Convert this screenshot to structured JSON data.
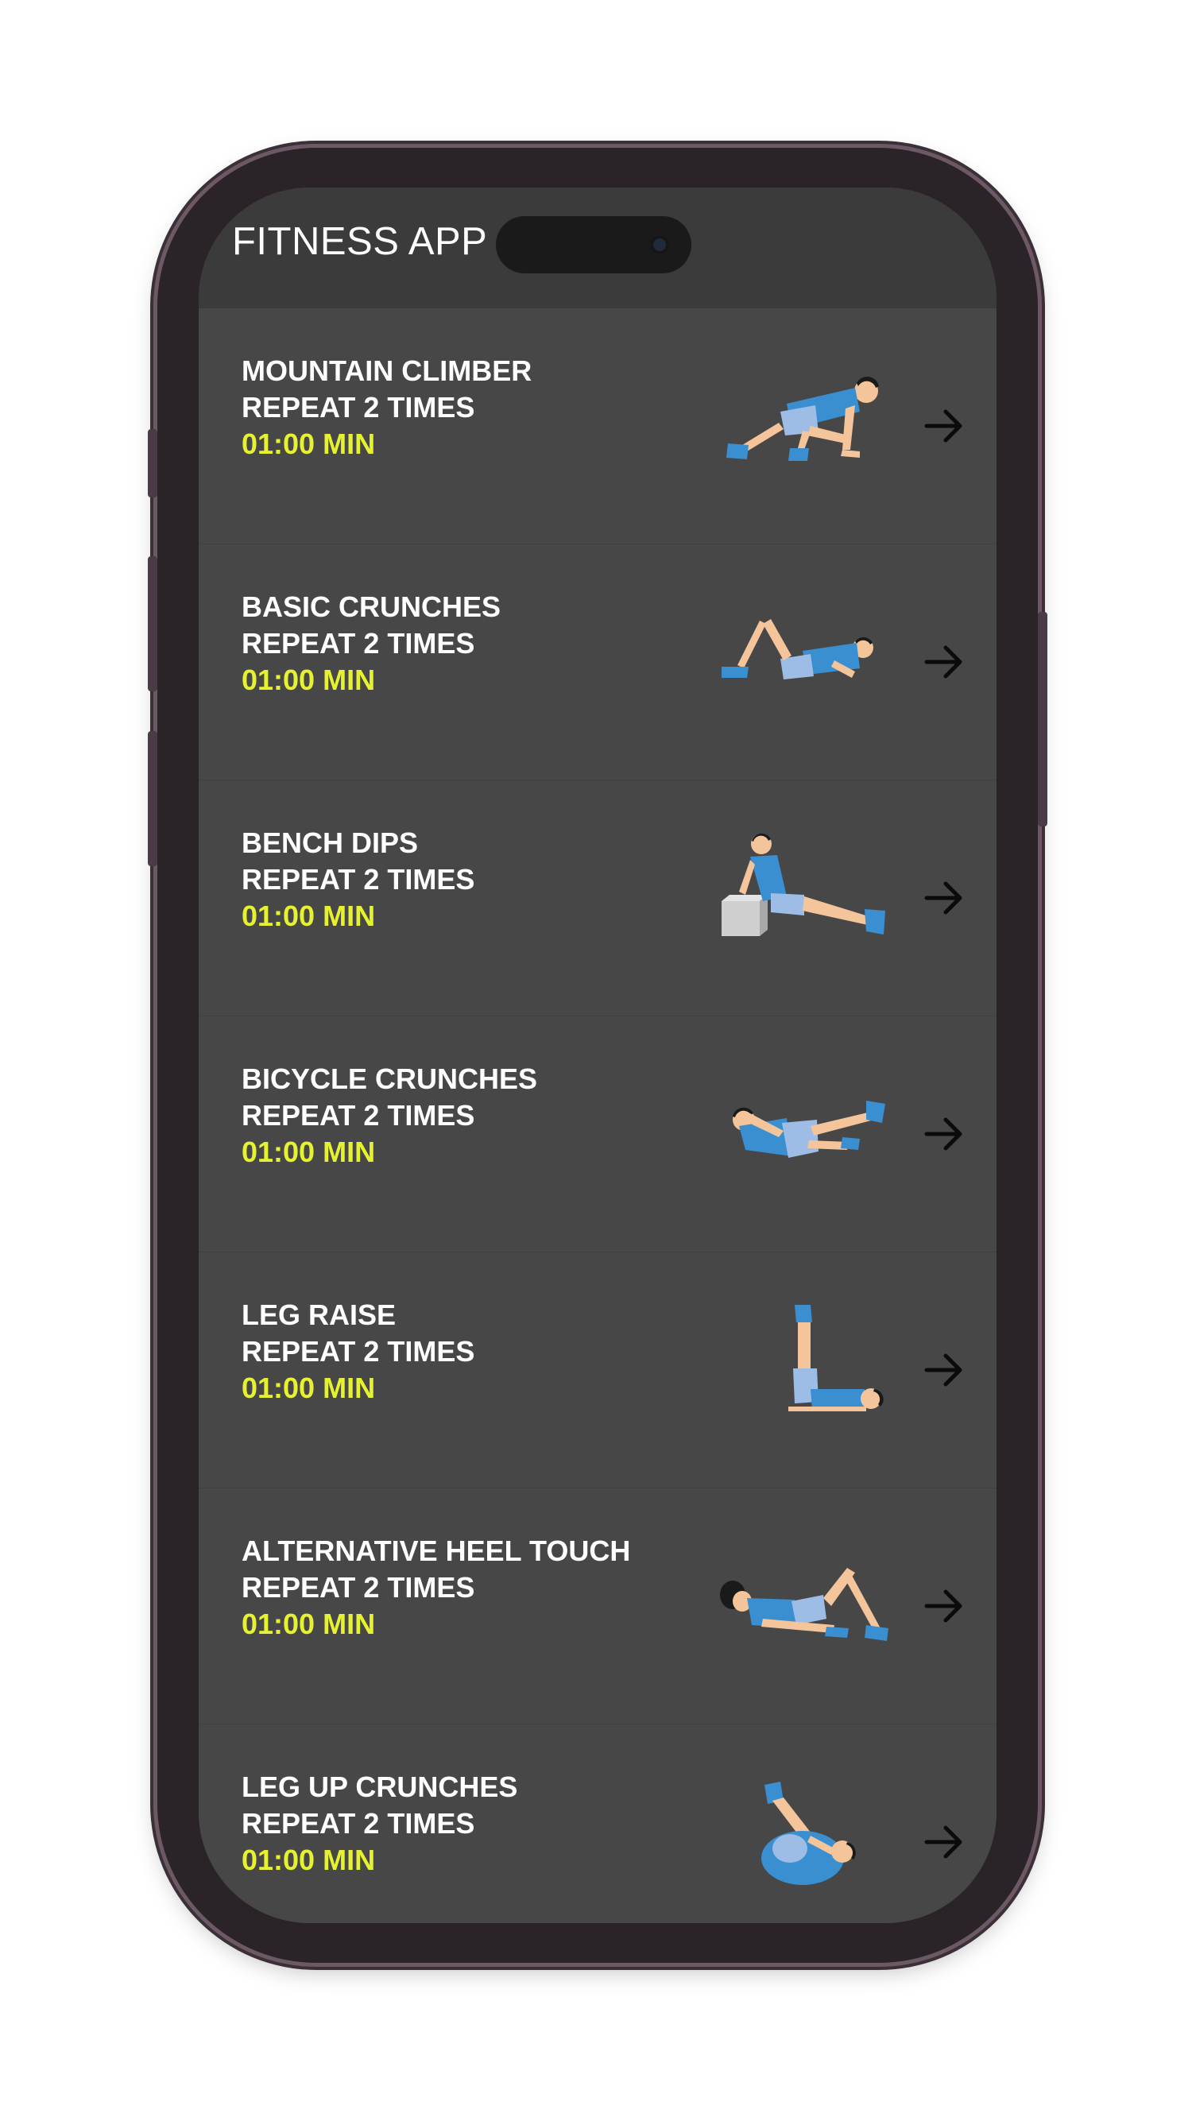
{
  "app": {
    "title": "FITNESS APP"
  },
  "exercises": [
    {
      "name": "MOUNTAIN CLIMBER",
      "repeat": "REPEAT 2 TIMES",
      "duration": "01:00 MIN",
      "illustration": "mountain-climber-figure"
    },
    {
      "name": "BASIC CRUNCHES",
      "repeat": "REPEAT 2 TIMES",
      "duration": "01:00 MIN",
      "illustration": "basic-crunches-figure"
    },
    {
      "name": "BENCH DIPS",
      "repeat": "REPEAT 2 TIMES",
      "duration": "01:00 MIN",
      "illustration": "bench-dips-figure"
    },
    {
      "name": "BICYCLE CRUNCHES",
      "repeat": "REPEAT 2 TIMES",
      "duration": "01:00 MIN",
      "illustration": "bicycle-crunches-figure"
    },
    {
      "name": "LEG RAISE",
      "repeat": "REPEAT 2 TIMES",
      "duration": "01:00 MIN",
      "illustration": "leg-raise-figure"
    },
    {
      "name": "ALTERNATIVE HEEL TOUCH",
      "repeat": "REPEAT 2 TIMES",
      "duration": "01:00 MIN",
      "illustration": "heel-touch-figure"
    },
    {
      "name": "LEG UP CRUNCHES",
      "repeat": "REPEAT 2 TIMES",
      "duration": "01:00 MIN",
      "illustration": "leg-up-crunches-figure"
    }
  ],
  "icons": {
    "row_action": "arrow-right-icon"
  },
  "colors": {
    "list_background": "#474747",
    "header_background": "#3b3b3b",
    "title_text": "#ffffff",
    "duration_text": "#e6f22f",
    "figure_shirt": "#3a8fd1",
    "figure_shorts": "#9dbde6",
    "figure_skin": "#f4c49b"
  }
}
